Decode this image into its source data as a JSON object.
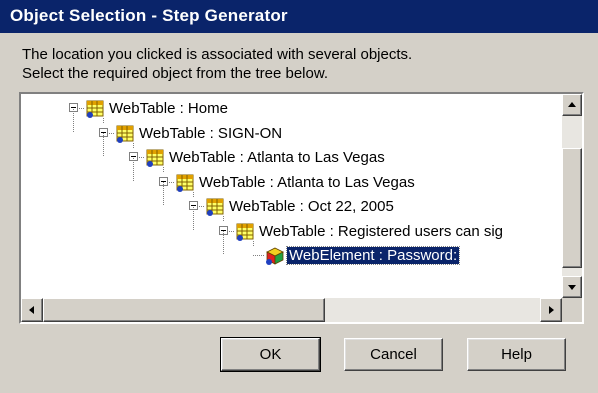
{
  "dialog": {
    "title": "Object Selection - Step Generator",
    "instruction_line1": "The location you clicked is associated with several objects.",
    "instruction_line2": "Select the required object from the tree below."
  },
  "tree": {
    "items": [
      {
        "label": "WebTable : Home",
        "icon": "webtable-grid-icon",
        "expanded": true,
        "selected": false
      },
      {
        "label": "WebTable : SIGN-ON",
        "icon": "webtable-grid-icon",
        "expanded": true,
        "selected": false
      },
      {
        "label": "WebTable : Atlanta to Las Vegas",
        "icon": "webtable-grid-icon",
        "expanded": true,
        "selected": false
      },
      {
        "label": "WebTable : Atlanta to Las Vegas",
        "icon": "webtable-grid-icon",
        "expanded": true,
        "selected": false
      },
      {
        "label": "WebTable : Oct 22, 2005",
        "icon": "webtable-grid-icon",
        "expanded": true,
        "selected": false
      },
      {
        "label": "WebTable : Registered users can sig",
        "icon": "webtable-grid-icon",
        "expanded": true,
        "selected": false
      },
      {
        "label": "WebElement : Password:",
        "icon": "webelement-cube-icon",
        "expanded": false,
        "selected": true
      }
    ]
  },
  "buttons": {
    "ok": "OK",
    "cancel": "Cancel",
    "help": "Help"
  },
  "colors": {
    "titlebar": "#0a246a",
    "selection": "#0a246a",
    "face": "#d4d0c8"
  }
}
